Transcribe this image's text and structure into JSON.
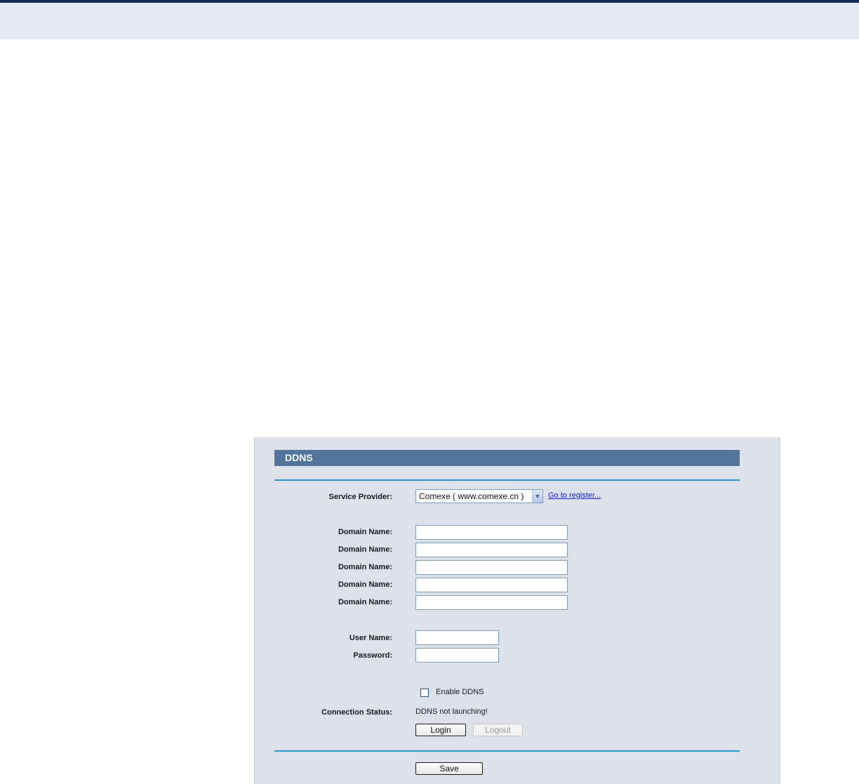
{
  "panel": {
    "title": "DDNS"
  },
  "service_provider": {
    "label": "Service Provider:",
    "selected": "Comexe ( www.comexe.cn )",
    "register_link": "Go to register..."
  },
  "domain_names": [
    {
      "label": "Domain Name:",
      "value": ""
    },
    {
      "label": "Domain Name:",
      "value": ""
    },
    {
      "label": "Domain Name:",
      "value": ""
    },
    {
      "label": "Domain Name:",
      "value": ""
    },
    {
      "label": "Domain Name:",
      "value": ""
    }
  ],
  "account": {
    "username_label": "User Name:",
    "username_value": "",
    "password_label": "Password:",
    "password_value": ""
  },
  "enable_ddns": {
    "label": "Enable DDNS",
    "checked": false
  },
  "connection_status": {
    "label": "Connection Status:",
    "value": "DDNS not launching!"
  },
  "buttons": {
    "login": "Login",
    "logout": "Logout",
    "save": "Save"
  },
  "colors": {
    "header": "#51759b",
    "rule": "#2c95cb",
    "panel_bg": "#dce1ea",
    "top_bar": "#e5e8ef",
    "link": "#1a1ad8"
  }
}
